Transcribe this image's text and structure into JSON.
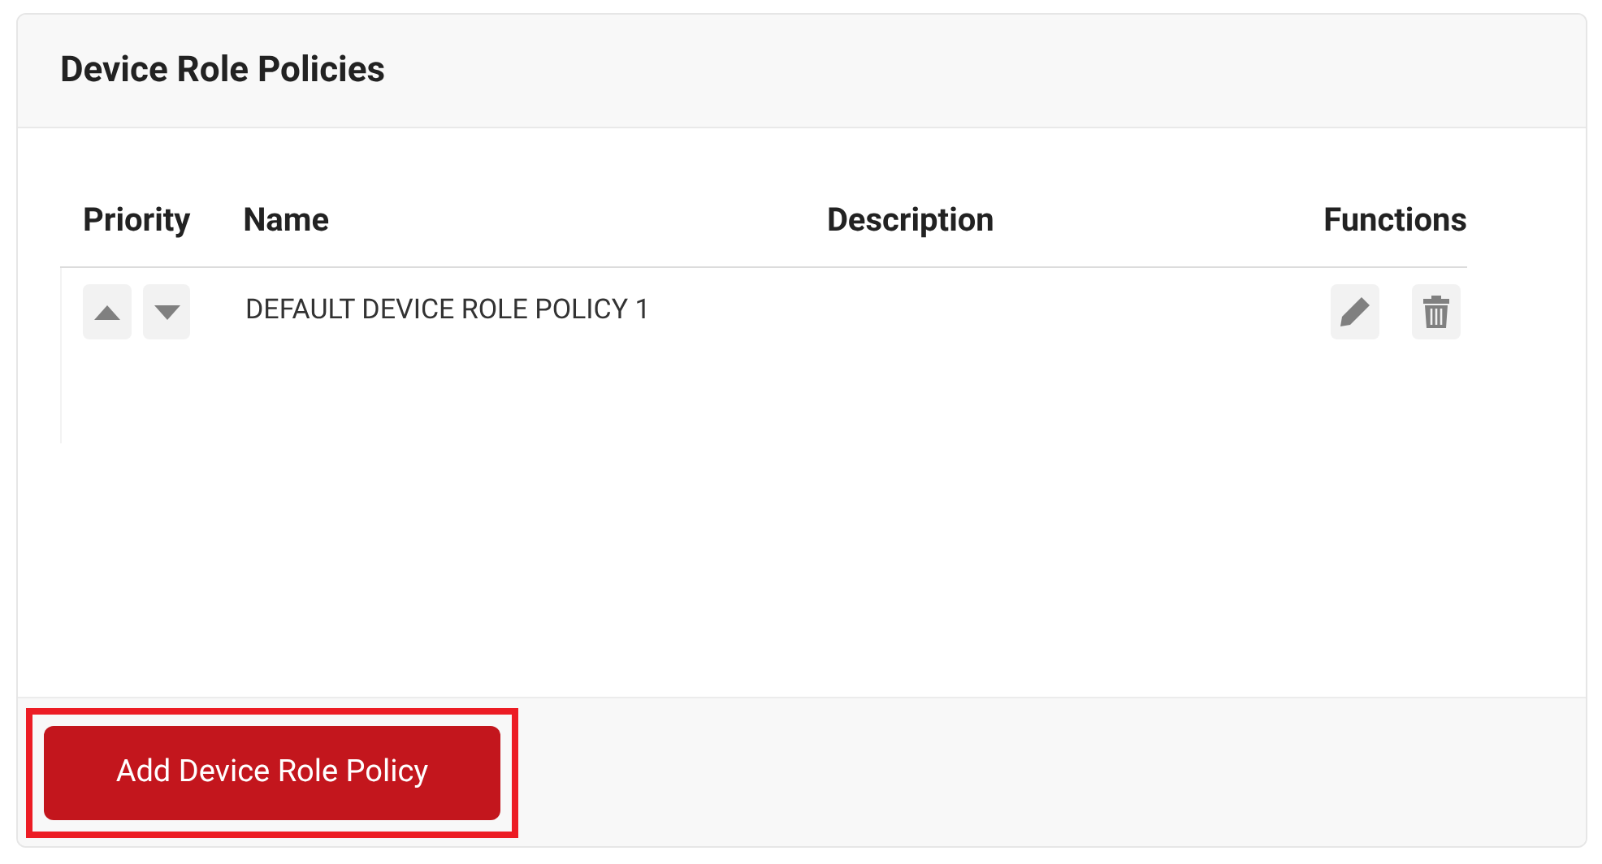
{
  "panel": {
    "title": "Device Role Policies"
  },
  "table": {
    "columns": [
      "Priority",
      "Name",
      "Description",
      "Functions"
    ],
    "rows": [
      {
        "name": "DEFAULT DEVICE ROLE POLICY 1"
      }
    ]
  },
  "footer": {
    "button": {
      "label": "Add Device Role Policy",
      "highlighted": true
    }
  }
}
